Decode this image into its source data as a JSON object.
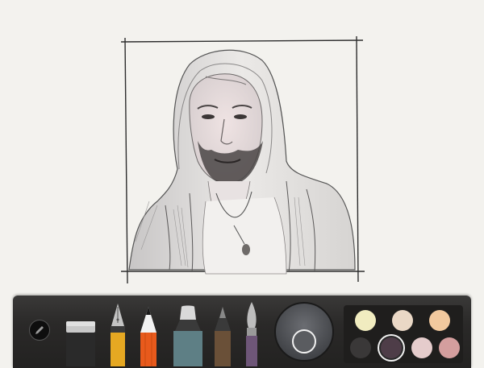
{
  "app": {
    "background_color": "#f3f2ee",
    "toolbar_color": "#2a2928"
  },
  "canvas": {
    "content": "pencil-sketch-portrait"
  },
  "toolbar": {
    "palette_toggle": {
      "icon": "pencil-icon"
    },
    "tools": [
      {
        "name": "eraser",
        "icon": "eraser-icon",
        "color": "#9a9a9a"
      },
      {
        "name": "fountain-pen",
        "icon": "fountain-pen-icon",
        "color": "#e6a822"
      },
      {
        "name": "pencil",
        "icon": "pencil-tool-icon",
        "color": "#e85a1c",
        "selected": true
      },
      {
        "name": "marker",
        "icon": "marker-icon",
        "color": "#5e7f85"
      },
      {
        "name": "outline-pen",
        "icon": "outline-pen-icon",
        "color": "#6a5038"
      },
      {
        "name": "brush",
        "icon": "brush-icon",
        "color": "#6e5678"
      }
    ],
    "mixer": {
      "icon": "color-mixer-icon",
      "current_color": "#5a5c60"
    },
    "swatches": [
      {
        "color": "#f1ecc0",
        "selected": false
      },
      {
        "color": "#ead8c6",
        "selected": false
      },
      {
        "color": "#f2c99e",
        "selected": false
      },
      {
        "color": "#3a3838",
        "selected": false
      },
      {
        "color": "#4e3d48",
        "selected": true
      },
      {
        "color": "#e5cccc",
        "selected": false
      },
      {
        "color": "#d49e9e",
        "selected": false
      }
    ]
  }
}
